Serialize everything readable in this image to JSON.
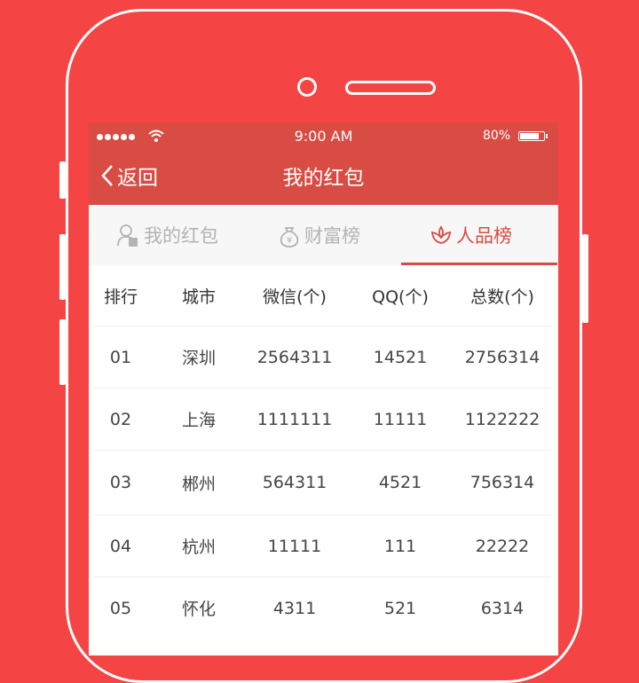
{
  "status_bar": {
    "time": "9:00 AM",
    "battery_percent": "80%",
    "battery_level": 0.8
  },
  "nav": {
    "back_label": "返回",
    "title": "我的红包"
  },
  "tabs": [
    {
      "label": "我的红包",
      "icon": "person-redpacket-icon",
      "active": false
    },
    {
      "label": "财富榜",
      "icon": "money-bag-icon",
      "active": false
    },
    {
      "label": "人品榜",
      "icon": "flower-icon",
      "active": true
    }
  ],
  "table": {
    "headers": [
      "排行",
      "城市",
      "微信(个)",
      "QQ(个)",
      "总数(个)"
    ],
    "rows": [
      [
        "01",
        "深圳",
        "2564311",
        "14521",
        "2756314"
      ],
      [
        "02",
        "上海",
        "1111111",
        "11111",
        "1122222"
      ],
      [
        "03",
        "郴州",
        "564311",
        "4521",
        "756314"
      ],
      [
        "04",
        "杭州",
        "11111",
        "111",
        "22222"
      ],
      [
        "05",
        "怀化",
        "4311",
        "521",
        "6314"
      ]
    ]
  },
  "colors": {
    "background": "#f44444",
    "header": "#d84c43",
    "active_tab": "#d84c43",
    "inactive_tab": "#b3b3b3"
  }
}
